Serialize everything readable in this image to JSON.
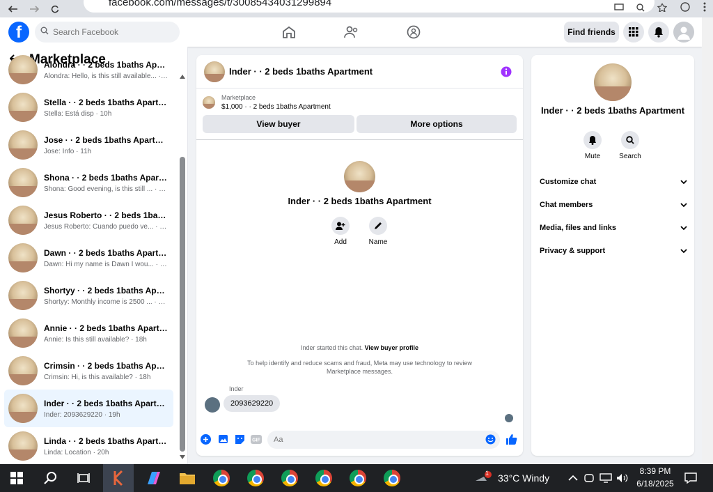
{
  "browser": {
    "url": "facebook.com/messages/t/30085434031299894"
  },
  "header": {
    "logo": "f",
    "search_placeholder": "Search Facebook",
    "find_friends": "Find friends"
  },
  "sidebar": {
    "title": "Marketplace",
    "conversations": [
      {
        "name": "Alondra · · 2 beds 1baths Apartment",
        "preview": "Alondra: Hello, is this still available... · 9h"
      },
      {
        "name": "Stella · · 2 beds 1baths Apartment",
        "preview": "Stella: Está disp · 10h"
      },
      {
        "name": "Jose · · 2 beds 1baths Apartment",
        "preview": "Jose: Info · 11h"
      },
      {
        "name": "Shona · · 2 beds 1baths Apartm...",
        "preview": "Shona: Good evening, is this still ... · 11h"
      },
      {
        "name": "Jesus Roberto · · 2 beds 1baths ...",
        "preview": "Jesus Roberto: Cuando puedo ve... · 17h"
      },
      {
        "name": "Dawn · · 2 beds 1baths Apartme...",
        "preview": "Dawn: Hi my name is Dawn I wou... · 17h"
      },
      {
        "name": "Shortyy · · 2 beds 1baths Apart...",
        "preview": "Shortyy: Monthly income is 2500 ... · 18h"
      },
      {
        "name": "Annie · · 2 beds 1baths Apartme...",
        "preview": "Annie: Is this still available? · 18h"
      },
      {
        "name": "Crimsin · · 2 beds 1baths Apart...",
        "preview": "Crimsin: Hi, is this available? · 18h"
      },
      {
        "name": "Inder · · 2 beds 1baths Apartment",
        "preview": "Inder: 2093629220 · 19h",
        "active": true
      },
      {
        "name": "Linda · · 2 beds 1baths Apartment",
        "preview": "Linda: Location · 20h"
      }
    ]
  },
  "chat": {
    "title": "Inder · · 2 beds 1baths Apartment",
    "listing_label": "Marketplace",
    "listing_price": "$1,000 · · 2 beds 1baths Apartment",
    "view_buyer": "View buyer",
    "more_options": "More options",
    "center_name": "Inder · · 2 beds 1baths Apartment",
    "add_label": "Add",
    "name_label": "Name",
    "started_text": "Inder started this chat.",
    "view_profile": "View buyer profile",
    "scam_notice_1": "To help identify and reduce scams and fraud, Meta may use technology to review",
    "scam_notice_2": "Marketplace messages.",
    "sender": "Inder",
    "message": "2093629220",
    "composer_placeholder": "Aa"
  },
  "info": {
    "name": "Inder · · 2 beds 1baths Apartment",
    "mute": "Mute",
    "search": "Search",
    "rows": [
      "Customize chat",
      "Chat members",
      "Media, files and links",
      "Privacy & support"
    ]
  },
  "taskbar": {
    "weather": "33°C  Windy",
    "time": "8:39 PM",
    "date": "6/18/2025",
    "notification_count": "1"
  },
  "colors": {
    "accent": "#0866ff",
    "info_icon": "#a033ff",
    "active_row": "#ebf5ff"
  }
}
